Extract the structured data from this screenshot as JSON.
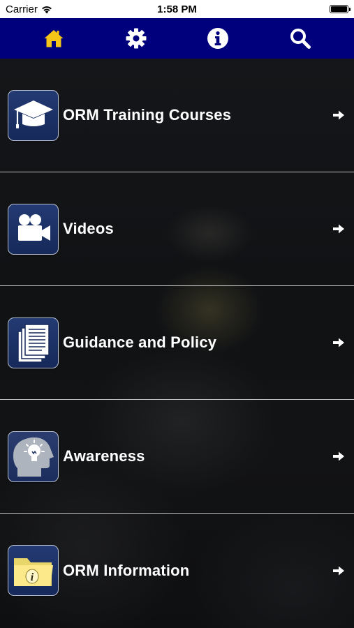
{
  "status_bar": {
    "carrier": "Carrier",
    "time": "1:58 PM"
  },
  "navbar": {
    "background": "#00007d",
    "active_color": "#f5c518",
    "icon_color": "#ffffff",
    "buttons": [
      {
        "icon": "home-icon",
        "active": true
      },
      {
        "icon": "gear-icon",
        "active": false
      },
      {
        "icon": "info-icon",
        "active": false
      },
      {
        "icon": "search-icon",
        "active": false
      }
    ]
  },
  "menu": {
    "items": [
      {
        "label": "ORM Training Courses",
        "icon": "graduation-cap-icon"
      },
      {
        "label": "Videos",
        "icon": "video-camera-icon"
      },
      {
        "label": "Guidance and Policy",
        "icon": "documents-icon"
      },
      {
        "label": "Awareness",
        "icon": "head-lightbulb-icon"
      },
      {
        "label": "ORM Information",
        "icon": "info-folder-icon"
      }
    ],
    "arrow_icon": "right-arrow-icon"
  }
}
